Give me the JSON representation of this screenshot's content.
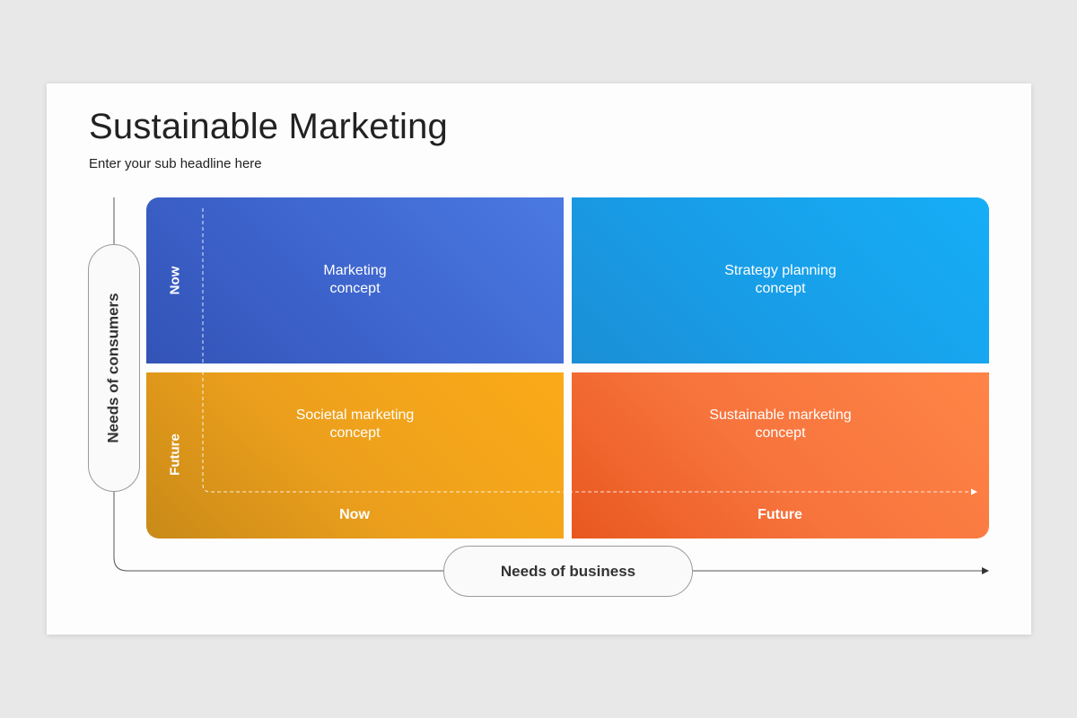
{
  "slide": {
    "title": "Sustainable Marketing",
    "subtitle": "Enter your sub headline here"
  },
  "matrix": {
    "y_axis_label": "Needs of consumers",
    "x_axis_label": "Needs of business",
    "rows": [
      "Now",
      "Future"
    ],
    "columns": [
      "Now",
      "Future"
    ],
    "quadrants": [
      {
        "label": "Marketing\nconcept",
        "color": "#4169d6"
      },
      {
        "label": "Strategy planning\nconcept",
        "color": "#17a1ec"
      },
      {
        "label": "Societal marketing\nconcept",
        "color": "#f0a21b"
      },
      {
        "label": "Sustainable marketing\nconcept",
        "color": "#f66f36"
      }
    ]
  }
}
